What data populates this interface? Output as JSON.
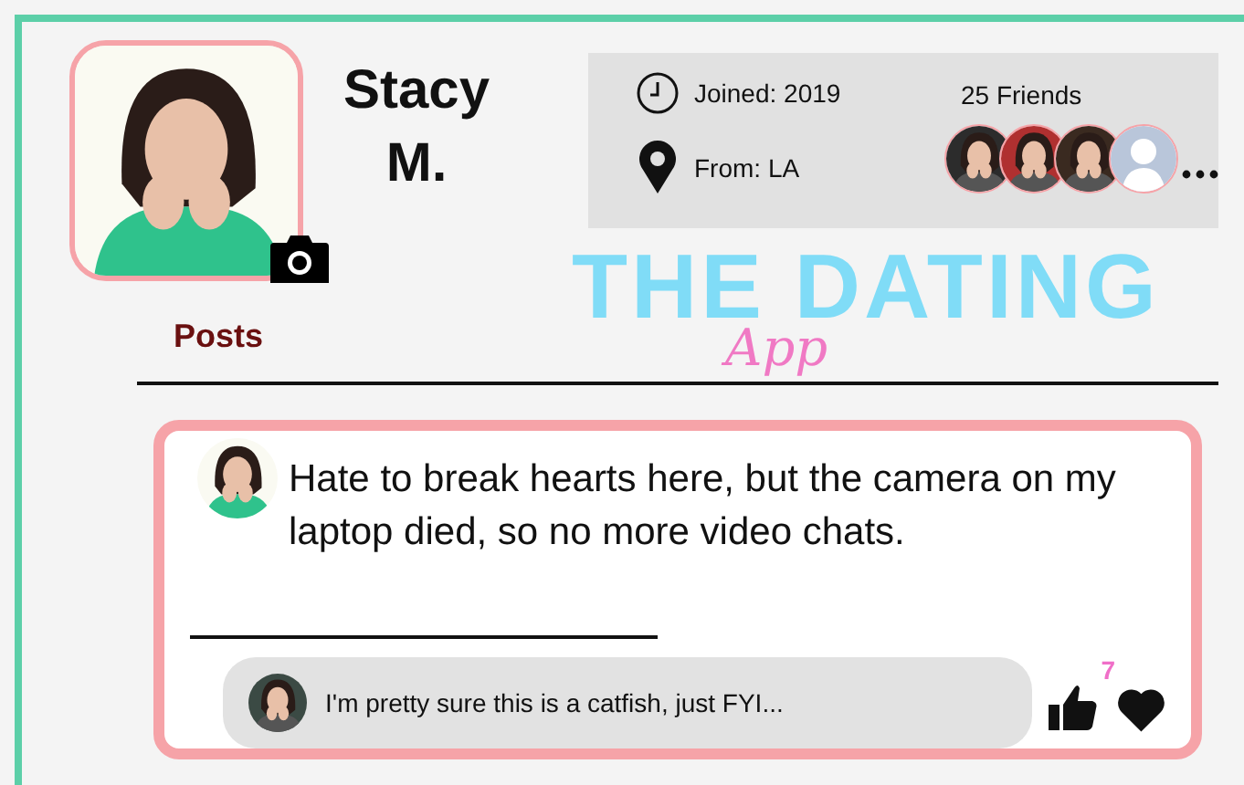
{
  "profile": {
    "name_lines": [
      "Stacy",
      "M."
    ]
  },
  "info": {
    "joined": "Joined: 2019",
    "from": "From: LA",
    "friends_label": "25 Friends",
    "friends": [
      {
        "kind": "picture"
      },
      {
        "kind": "picture"
      },
      {
        "kind": "picture"
      },
      {
        "kind": "placeholder"
      }
    ]
  },
  "logo": {
    "title": "THE DATING",
    "script": "App"
  },
  "section_title": "Posts",
  "post": {
    "text": "Hate to break hearts here, but the camera on my laptop died, so no more video chats.",
    "comment": "I'm pretty sure this is a catfish, just FYI...",
    "likes": "7"
  }
}
